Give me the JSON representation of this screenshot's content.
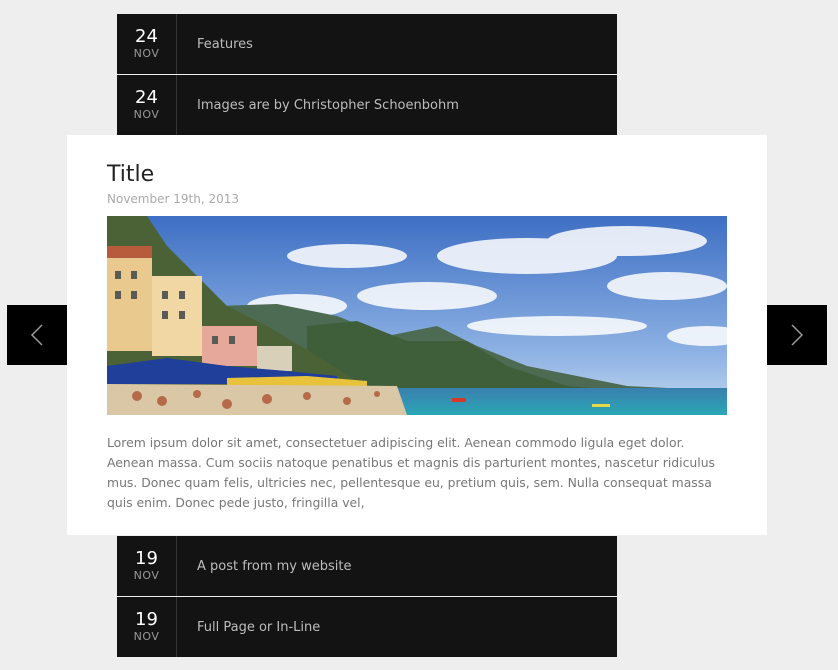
{
  "timeline": [
    {
      "day": "24",
      "month": "NOV",
      "title": "Features"
    },
    {
      "day": "24",
      "month": "NOV",
      "title": "Images are by Christopher Schoenbohm"
    },
    {
      "day": "19",
      "month": "NOV",
      "title": "A post from my website"
    },
    {
      "day": "19",
      "month": "NOV",
      "title": "Full Page or In-Line"
    }
  ],
  "featured": {
    "title": "Title",
    "date": "November 19th, 2013",
    "excerpt": "Lorem ipsum dolor sit amet, consectetuer adipiscing elit. Aenean commodo ligula eget dolor. Aenean massa. Cum sociis natoque penatibus et magnis dis parturient montes, nascetur ridiculus mus. Donec quam felis, ultricies nec, pellentesque eu, pretium quis, sem. Nulla consequat massa quis enim. Donec pede justo, fringilla vel,"
  },
  "nav": {
    "prev_icon": "chevron-left-icon",
    "next_icon": "chevron-right-icon"
  },
  "colors": {
    "row_bg": "#131313",
    "page_bg": "#eeeeee",
    "arrow_bg": "#000000"
  }
}
